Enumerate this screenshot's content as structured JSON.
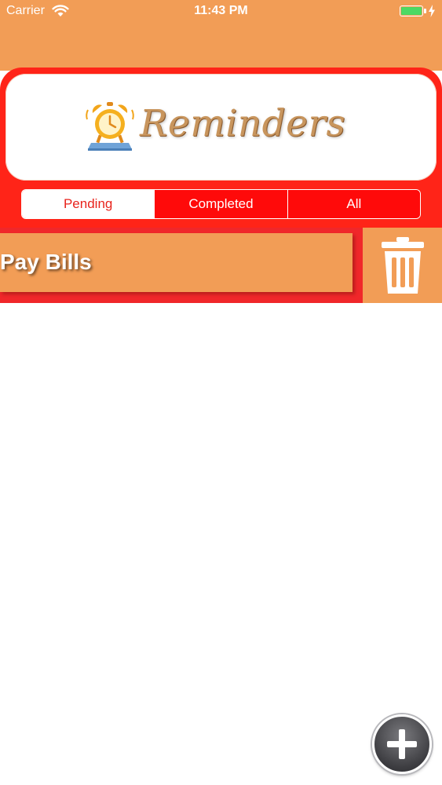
{
  "status_bar": {
    "carrier": "Carrier",
    "time": "11:43 PM",
    "battery_level": 1.0,
    "wifi_icon": "wifi-icon",
    "charging_icon": "bolt-icon"
  },
  "header": {
    "title": "Reminders",
    "logo_icon": "alarm-clock-icon"
  },
  "tabs": [
    {
      "label": "Pending",
      "selected": true
    },
    {
      "label": "Completed",
      "selected": false
    },
    {
      "label": "All",
      "selected": false
    }
  ],
  "reminders": [
    {
      "title": "Pay Bills",
      "action_icon": "trash-icon"
    }
  ],
  "fab": {
    "icon": "plus-icon"
  },
  "colors": {
    "primary_orange": "#f29d56",
    "accent_red": "#ff2418",
    "segment_red": "#ff0a0a",
    "battery_green": "#4cd964"
  }
}
